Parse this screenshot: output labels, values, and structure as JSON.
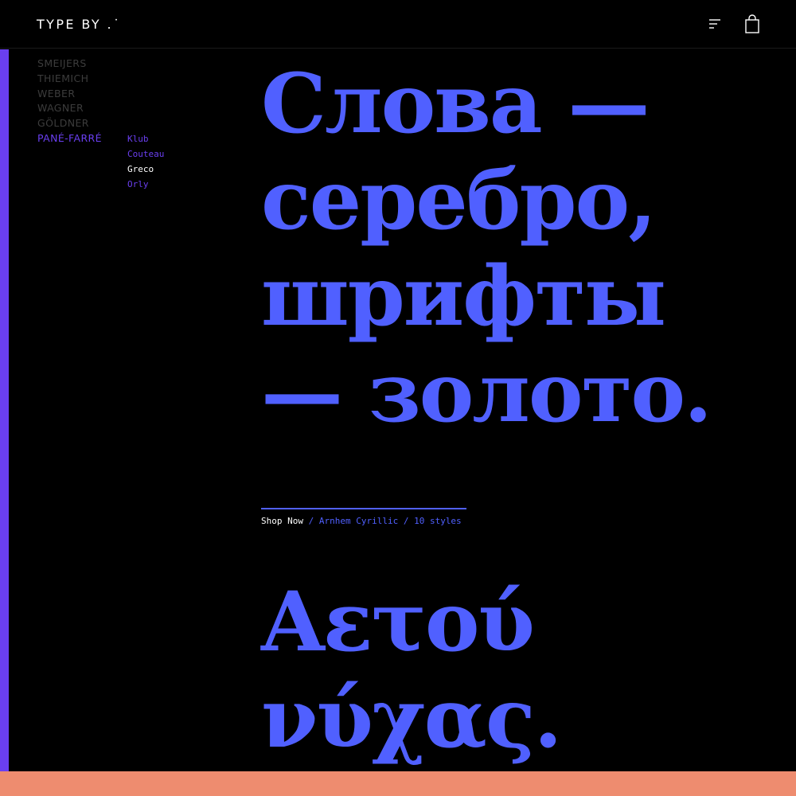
{
  "header": {
    "logo_text": "TYPE BY .˙",
    "menu_icon": "menu-lines-icon",
    "cart_icon": "shopping-bag-icon"
  },
  "colors": {
    "background": "#000000",
    "accent": "#5060ff",
    "active": "#6a3ff0",
    "muted_text": "#3c3c3c",
    "white": "#ffffff",
    "bottom_bar": "#ee8c6f"
  },
  "sidebar": {
    "foundries": [
      {
        "label": "SMEIJERS",
        "active": false
      },
      {
        "label": "THIEMICH",
        "active": false
      },
      {
        "label": "WEBER",
        "active": false
      },
      {
        "label": "WAGNER",
        "active": false
      },
      {
        "label": "GÖLDNER",
        "active": false
      },
      {
        "label": "PANÉ-FARRÉ",
        "active": true
      }
    ],
    "fonts": [
      {
        "label": "Klub",
        "current": false
      },
      {
        "label": "Couteau",
        "current": false
      },
      {
        "label": "Greco",
        "current": true
      },
      {
        "label": "Orly",
        "current": false
      }
    ]
  },
  "main": {
    "specimen_cyrillic": [
      "Слова —",
      "серебро,",
      "шрифты",
      "— золото."
    ],
    "shop": {
      "cta": "Shop Now",
      "separator": " / ",
      "font_name": "Arnhem Cyrillic",
      "styles": "10 styles"
    },
    "specimen_greek": [
      "Αετού",
      "νύχας."
    ]
  }
}
